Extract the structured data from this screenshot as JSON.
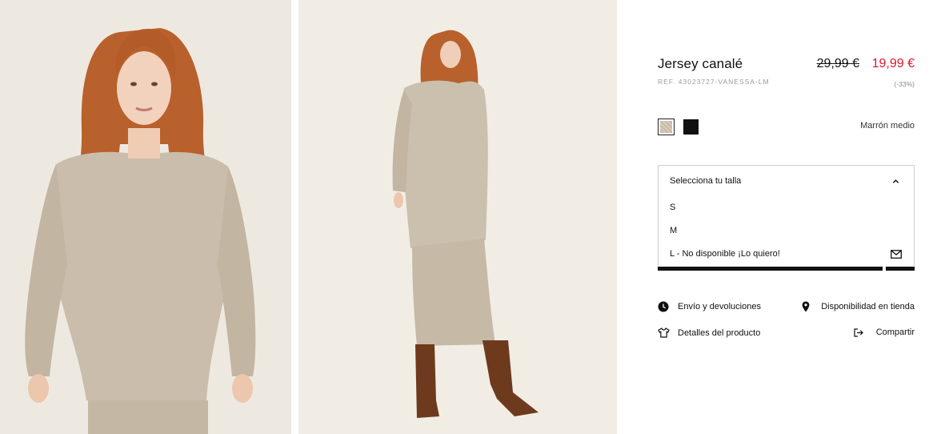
{
  "product": {
    "title": "Jersey canalé",
    "ref": "REF. 43023727-VANESSA-LM",
    "price_old": "29,99 €",
    "price_new": "19,99 €",
    "discount": "(-33%)"
  },
  "colors": {
    "selected_name": "Marrón medio",
    "swatches": [
      {
        "name": "Marrón medio",
        "hex": "#d3c6b2"
      },
      {
        "name": "Negro",
        "hex": "#111111"
      }
    ]
  },
  "size_selector": {
    "header": "Selecciona tu talla",
    "options": [
      "S",
      "M",
      "L - No disponible ¡Lo quiero!"
    ]
  },
  "actions": {
    "envio": "Envío y devoluciones",
    "disponibilidad": "Disponibilidad en tienda",
    "detalles": "Detalles del producto",
    "compartir": "Compartir"
  },
  "theme": {
    "accent_sale": "#e0162b",
    "text": "#111111",
    "muted": "#9a9a9a",
    "photo_bg": "#efebe3",
    "garment": "#c9bcaa"
  }
}
